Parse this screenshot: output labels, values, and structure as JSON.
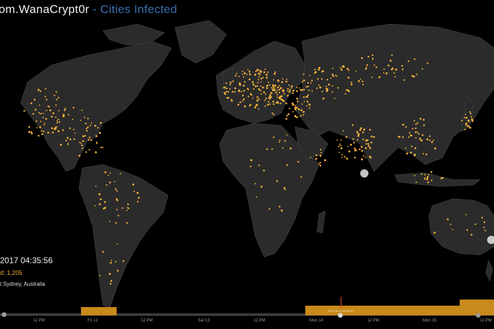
{
  "header": {
    "title_main": "om.WanaCrypt0r",
    "title_sep": " - ",
    "title_sub": "Cities Infected"
  },
  "info": {
    "datetime": "2017 04:35:56",
    "count": "d: 1,205",
    "location": "t Sydney, Australia"
  },
  "timeline": {
    "current_marker": "2017.05.14 04:35:56",
    "ticks": [
      {
        "label": "12 PM"
      },
      {
        "label": "Fri 12"
      },
      {
        "label": "12 PM"
      },
      {
        "label": "Sat 13"
      },
      {
        "label": "12 PM"
      },
      {
        "label": "Mon 14"
      },
      {
        "label": "12 PM"
      },
      {
        "label": "Mon 15"
      },
      {
        "label": "12 PM"
      }
    ]
  },
  "colors": {
    "background": "#000000",
    "land": "#2b2b2b",
    "border": "#4a4a4a",
    "infection": "#f4b13a",
    "highlight": "#e6e6e6",
    "accent": "#3b6fb0",
    "bar": "#c88a1a"
  }
}
